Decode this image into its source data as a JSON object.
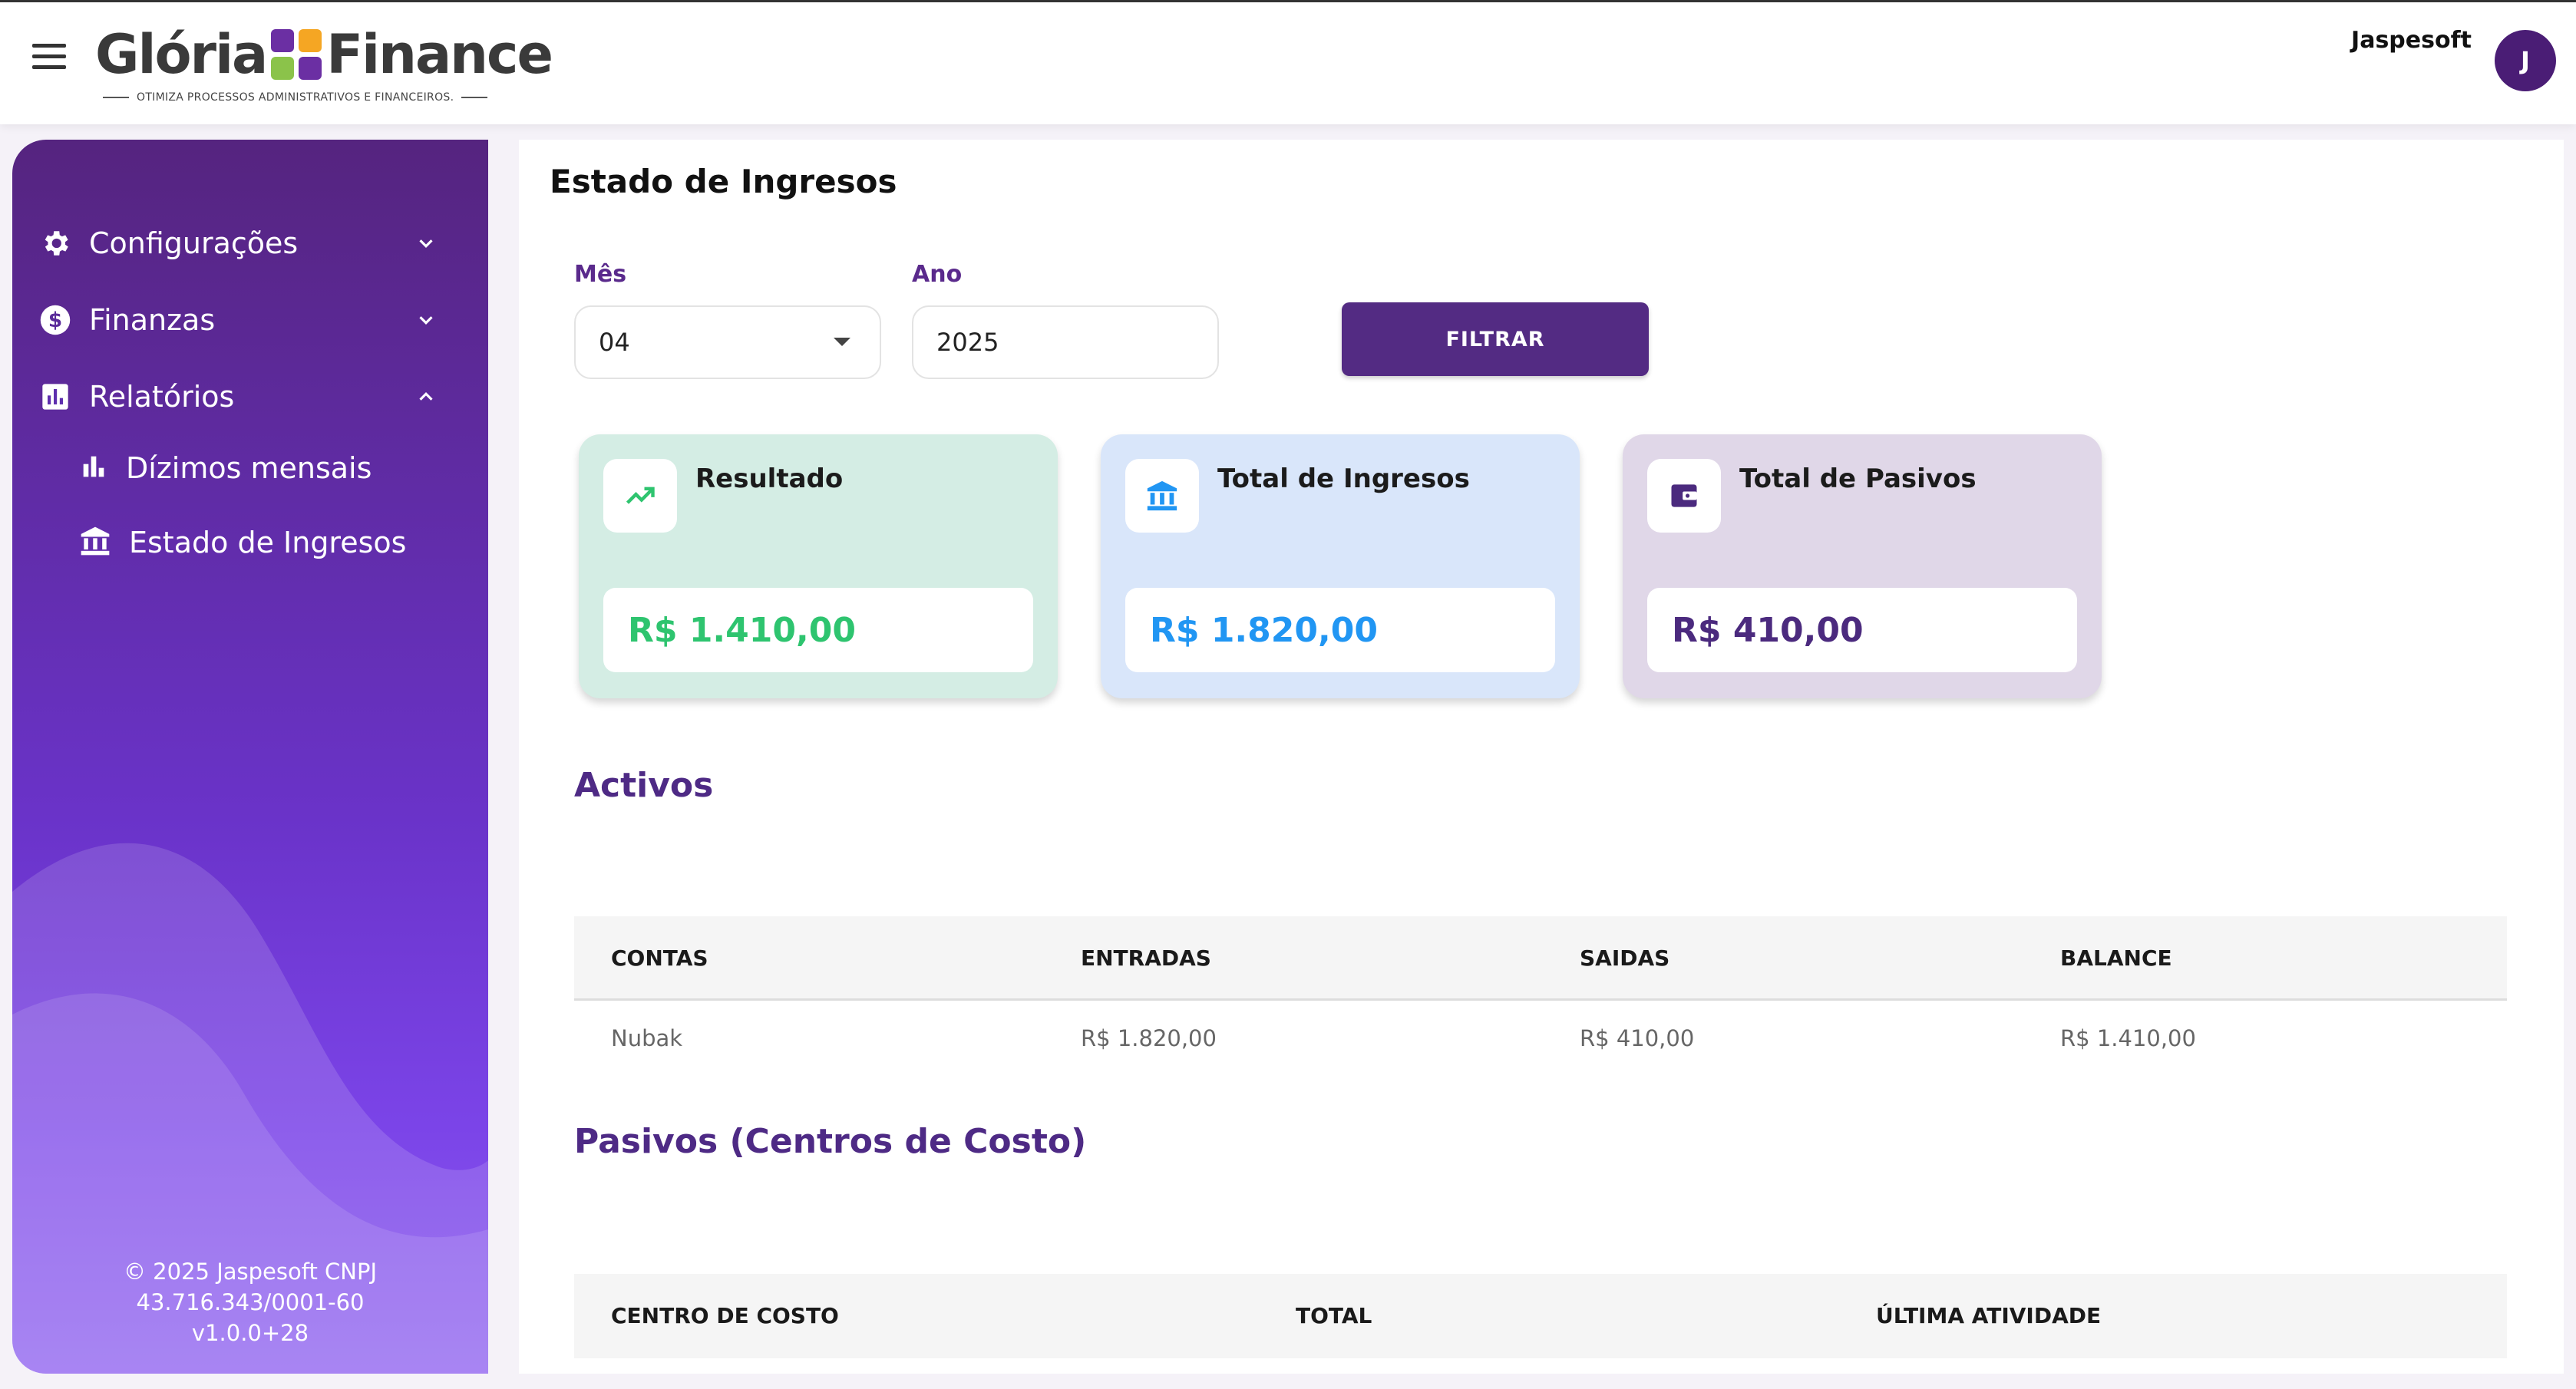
{
  "header": {
    "logo_left": "Glória",
    "logo_right": "Finance",
    "tagline": "OTIMIZA PROCESSOS ADMINISTRATIVOS E FINANCEIROS.",
    "user_name": "Jaspesoft",
    "avatar_initial": "J"
  },
  "sidebar": {
    "items": [
      {
        "label": "Configurações",
        "icon": "gear-icon"
      },
      {
        "label": "Finanzas",
        "icon": "dollar-icon"
      },
      {
        "label": "Relatórios",
        "icon": "report-icon"
      }
    ],
    "subitems": [
      {
        "label": "Dízimos mensais",
        "icon": "bar-chart-icon"
      },
      {
        "label": "Estado de Ingresos",
        "icon": "bank-icon"
      }
    ],
    "footer": {
      "line1": "© 2025 Jaspesoft CNPJ",
      "line2": "43.716.343/0001-60",
      "line3": "v1.0.0+28"
    }
  },
  "main": {
    "title": "Estado de Ingresos",
    "filters": {
      "month_label": "Mês",
      "month_value": "04",
      "year_label": "Ano",
      "year_value": "2025",
      "filter_button": "FILTRAR"
    },
    "cards": [
      {
        "title": "Resultado",
        "value": "R$ 1.410,00",
        "icon": "trending-up-icon",
        "bg": "#d4ede4",
        "value_color": "#2ec46f"
      },
      {
        "title": "Total de Ingresos",
        "value": "R$ 1.820,00",
        "icon": "bank-icon",
        "bg": "#d9e6fa",
        "value_color": "#2196f3"
      },
      {
        "title": "Total de Pasivos",
        "value": "R$ 410,00",
        "icon": "wallet-icon",
        "bg": "#e0d7e8",
        "value_color": "#4b2a7e"
      }
    ],
    "activos": {
      "title": "Activos",
      "headers": [
        "CONTAS",
        "ENTRADAS",
        "SAIDAS",
        "BALANCE"
      ],
      "rows": [
        [
          "Nubak",
          "R$ 1.820,00",
          "R$ 410,00",
          "R$ 1.410,00"
        ]
      ]
    },
    "pasivos": {
      "title": "Pasivos (Centros de Costo)",
      "headers": [
        "CENTRO DE COSTO",
        "TOTAL",
        "ÚLTIMA ATIVIDADE"
      ]
    }
  },
  "colors": {
    "brand": "#532b83",
    "sidebar_top": "#55247f",
    "sidebar_bottom": "#8c5ef0"
  }
}
